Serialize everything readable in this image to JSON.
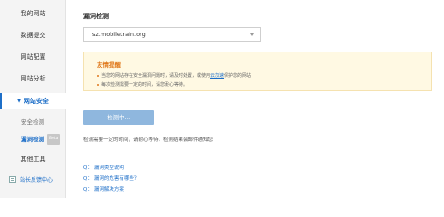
{
  "sidebar": {
    "items": [
      {
        "label": "我的网站"
      },
      {
        "label": "数据提交"
      },
      {
        "label": "网站配置"
      },
      {
        "label": "网站分析"
      },
      {
        "label": "网站安全"
      },
      {
        "label": "其他工具"
      }
    ],
    "sub_items": [
      {
        "label": "安全检测"
      },
      {
        "label": "漏洞检测",
        "badge": "Beta"
      }
    ],
    "feedback_label": "站长反馈中心"
  },
  "main": {
    "title": "漏洞检测",
    "domain_value": "sz.mobiletrain.org",
    "tip": {
      "title": "友情提醒",
      "line1_before": "当您的网站存在安全漏洞问题时，请及时处置，或使用",
      "line1_link": "云加速",
      "line1_after": "保护您的网站",
      "line2": "每次检测需要一定的时间，请您耐心等待。"
    },
    "detect_button": "检测中...",
    "hint": "检测需要一定的时间，请耐心等待，检测结果会邮件通知您",
    "questions": [
      {
        "prefix": "Q：",
        "text": "漏洞类型说明"
      },
      {
        "prefix": "Q：",
        "text": "漏洞的危害有哪些？"
      },
      {
        "prefix": "Q：",
        "text": "漏洞解决方案"
      }
    ]
  },
  "colors": {
    "accent": "#1e6fc8",
    "tip_title": "#e07a1e",
    "tip_bg": "#fff9e3",
    "button_disabled": "#8fb7de"
  }
}
